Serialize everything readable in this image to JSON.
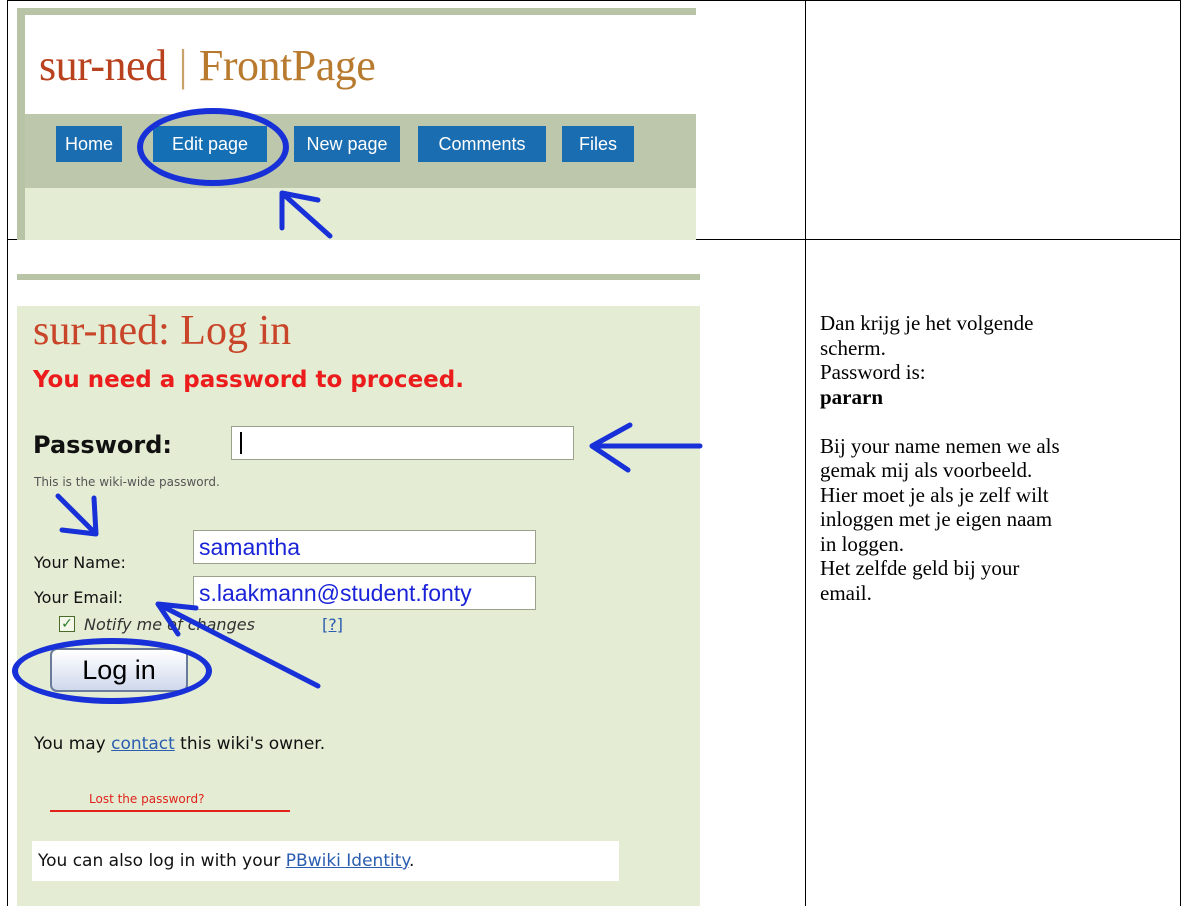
{
  "top_screenshot": {
    "site_name": "sur-ned",
    "separator": "|",
    "page_name": "FrontPage",
    "nav_tabs": [
      "Home",
      "Edit page",
      "New page",
      "Comments",
      "Files"
    ]
  },
  "login_screenshot": {
    "heading": "sur-ned: Log in",
    "notice": "You need a password to proceed.",
    "password_label": "Password:",
    "password_value": "",
    "password_hint": "This is the wiki-wide password.",
    "name_label": "Your Name:",
    "name_value": "samantha",
    "email_label": "Your Email:",
    "email_value": "s.laakmann@student.fonty",
    "notify_label": "Notify me of changes",
    "notify_checked": true,
    "notify_help": "[?]",
    "login_button": "Log in",
    "contact_prefix": "You may ",
    "contact_link": "contact",
    "contact_suffix": " this wiki's owner.",
    "lost_password": "Lost the password?",
    "identity_prefix": "You can also log in with your ",
    "identity_link": "PBwiki Identity",
    "identity_suffix": "."
  },
  "instructions": {
    "line1": "Dan krijg je het volgende",
    "line2": "scherm.",
    "line3": "Password is:",
    "password": "pararn",
    "line4": "Bij your name nemen we als",
    "line5": "gemak mij als voorbeeld.",
    "line6": "Hier moet je als je zelf wilt",
    "line7": "inloggen met je eigen naam",
    "line8": "in loggen.",
    "line9": "Het zelfde geld bij your",
    "line10": "email."
  },
  "colors": {
    "annotation_blue": "#1730d8",
    "tab_blue": "#1a6db0",
    "title_red": "#c8452a",
    "notice_red": "#ec1c1c",
    "wiki_bg": "#e4ecd4"
  }
}
